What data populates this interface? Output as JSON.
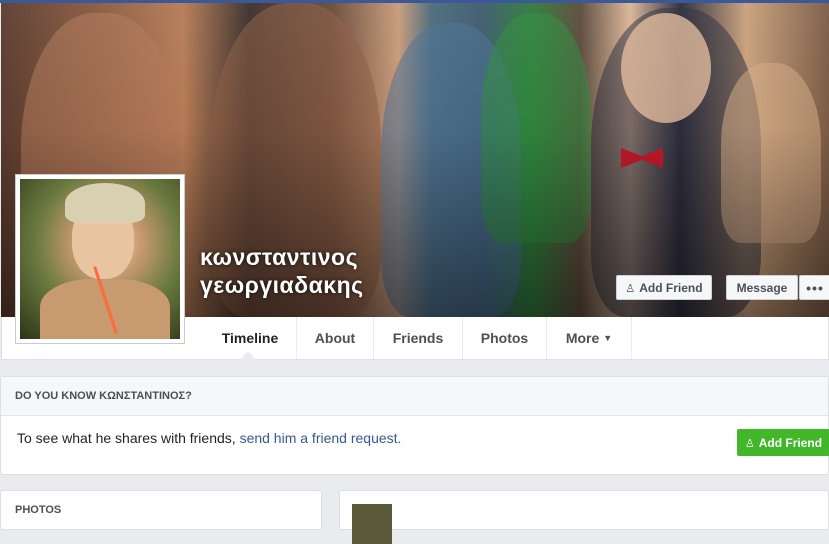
{
  "profile": {
    "name_line1": "κωνσταντινος",
    "name_line2": "γεωργιαδακης"
  },
  "cover_actions": {
    "add_friend": "Add Friend",
    "message": "Message",
    "more": "•••"
  },
  "nav": {
    "tabs": [
      {
        "label": "Timeline"
      },
      {
        "label": "About"
      },
      {
        "label": "Friends"
      },
      {
        "label": "Photos"
      },
      {
        "label": "More"
      }
    ]
  },
  "know_box": {
    "heading": "DO YOU KNOW ΚΩΝΣΤΑΝΤΙΝΟΣ?",
    "text": "To see what he shares with friends, ",
    "link": "send him a friend request.",
    "button": "Add Friend"
  },
  "photos": {
    "heading": "PHOTOS"
  },
  "colors": {
    "brand_blue": "#3b5998",
    "link_blue": "#365899",
    "green": "#42b72a",
    "background": "#e9ebee"
  },
  "icons": {
    "add_friend": "add-friend-icon",
    "more_caret": "caret-down-icon"
  }
}
